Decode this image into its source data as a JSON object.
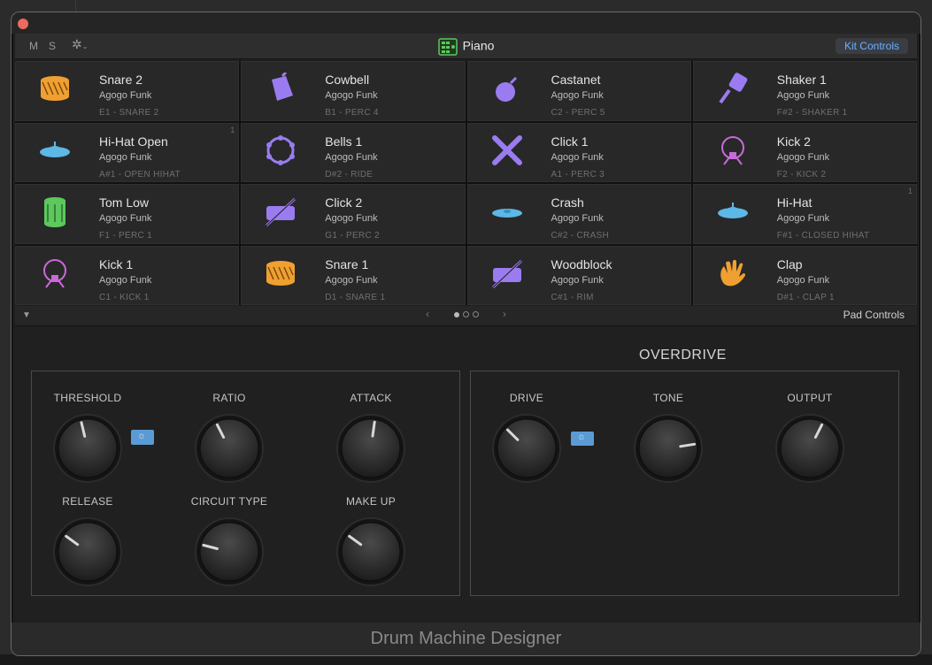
{
  "toolbar": {
    "mute_label": "M",
    "solo_label": "S",
    "gear_icon": "gear-icon",
    "title": "Piano",
    "kit_controls_label": "Kit Controls"
  },
  "pads": [
    {
      "name": "Snare 2",
      "kit": "Agogo Funk",
      "note": "E1 - SNARE 2",
      "icon": "snare-drum-icon",
      "color": "#f0a030",
      "badge": ""
    },
    {
      "name": "Cowbell",
      "kit": "Agogo Funk",
      "note": "B1 - PERC 4",
      "icon": "cowbell-icon",
      "color": "#9a7cf0",
      "badge": ""
    },
    {
      "name": "Castanet",
      "kit": "Agogo Funk",
      "note": "C2 - PERC 5",
      "icon": "castanet-icon",
      "color": "#9a7cf0",
      "badge": ""
    },
    {
      "name": "Shaker 1",
      "kit": "Agogo Funk",
      "note": "F#2 - SHAKER 1",
      "icon": "shaker-icon",
      "color": "#9a7cf0",
      "badge": ""
    },
    {
      "name": "Hi-Hat Open",
      "kit": "Agogo Funk",
      "note": "A#1 - OPEN HIHAT",
      "icon": "hihat-icon",
      "color": "#5cb8e6",
      "badge": "1"
    },
    {
      "name": "Bells 1",
      "kit": "Agogo Funk",
      "note": "D#2 - RIDE",
      "icon": "tambourine-icon",
      "color": "#9a7cf0",
      "badge": ""
    },
    {
      "name": "Click 1",
      "kit": "Agogo Funk",
      "note": "A1 - PERC 3",
      "icon": "crossed-sticks-icon",
      "color": "#9a7cf0",
      "badge": ""
    },
    {
      "name": "Kick 2",
      "kit": "Agogo Funk",
      "note": "F2 - KICK 2",
      "icon": "kick-drum-icon",
      "color": "#c86ad8",
      "badge": ""
    },
    {
      "name": "Tom Low",
      "kit": "Agogo Funk",
      "note": "F1 - PERC 1",
      "icon": "tom-drum-icon",
      "color": "#5dc85d",
      "badge": ""
    },
    {
      "name": "Click 2",
      "kit": "Agogo Funk",
      "note": "G1 - PERC 2",
      "icon": "rimshot-icon",
      "color": "#9a7cf0",
      "badge": ""
    },
    {
      "name": "Crash",
      "kit": "Agogo Funk",
      "note": "C#2 - CRASH",
      "icon": "crash-cymbal-icon",
      "color": "#5cb8e6",
      "badge": ""
    },
    {
      "name": "Hi-Hat",
      "kit": "Agogo Funk",
      "note": "F#1 - CLOSED HIHAT",
      "icon": "hihat-icon",
      "color": "#5cb8e6",
      "badge": "1"
    },
    {
      "name": "Kick 1",
      "kit": "Agogo Funk",
      "note": "C1 - KICK 1",
      "icon": "kick-drum-icon",
      "color": "#c86ad8",
      "badge": ""
    },
    {
      "name": "Snare 1",
      "kit": "Agogo Funk",
      "note": "D1 - SNARE 1",
      "icon": "snare-drum-icon",
      "color": "#f0a030",
      "badge": ""
    },
    {
      "name": "Woodblock",
      "kit": "Agogo Funk",
      "note": "C#1 - RIM",
      "icon": "rimshot-icon",
      "color": "#9a7cf0",
      "badge": ""
    },
    {
      "name": "Clap",
      "kit": "Agogo Funk",
      "note": "D#1 - CLAP 1",
      "icon": "hand-clap-icon",
      "color": "#f0a030",
      "badge": ""
    }
  ],
  "pad_controls": {
    "label": "Pad Controls",
    "page": 1,
    "pages": 3
  },
  "compressor": {
    "knobs": [
      {
        "label": "THRESHOLD",
        "value": 0.45
      },
      {
        "label": "RATIO",
        "value": 0.4
      },
      {
        "label": "ATTACK",
        "value": 0.53
      },
      {
        "label": "RELEASE",
        "value": 0.3
      },
      {
        "label": "CIRCUIT TYPE",
        "value": 0.22
      },
      {
        "label": "MAKE UP",
        "value": 0.3
      }
    ],
    "toggle_on": true
  },
  "overdrive": {
    "title": "OVERDRIVE",
    "knobs": [
      {
        "label": "DRIVE",
        "value": 0.33
      },
      {
        "label": "TONE",
        "value": 0.8
      },
      {
        "label": "OUTPUT",
        "value": 0.6
      }
    ],
    "toggle_on": true
  },
  "colors": {
    "accent": "#5b9bd5",
    "link": "#6cb0ff"
  },
  "footer": {
    "title": "Drum Machine Designer"
  }
}
